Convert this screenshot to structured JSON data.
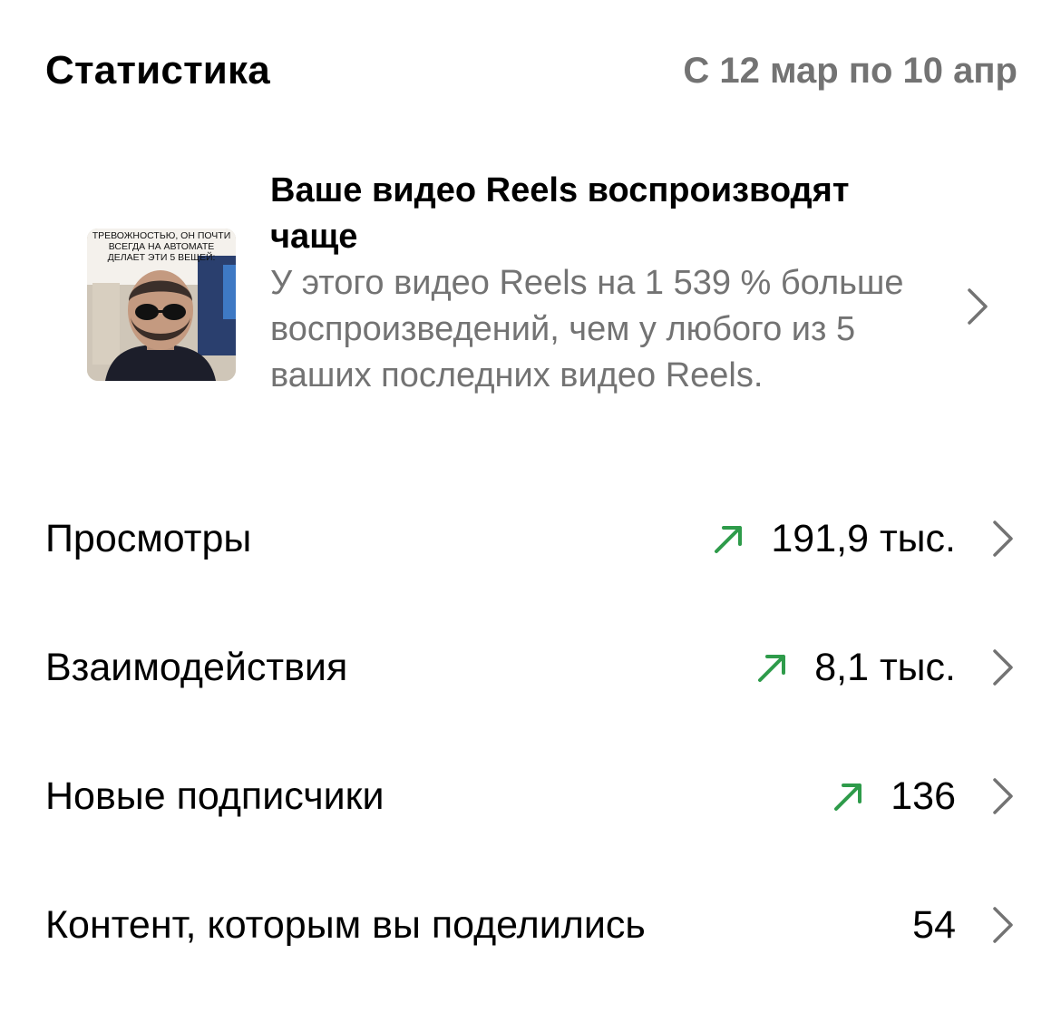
{
  "header": {
    "title": "Статистика",
    "date_range": "С 12 мар по 10 апр"
  },
  "insight": {
    "thumbnail_caption": "ТРЕВОЖНОСТЬЮ, ОН ПОЧТИ ВСЕГДА НА АВТОМАТЕ ДЕЛАЕТ ЭТИ 5 ВЕЩЕЙ:",
    "title": "Ваше видео Reels воспроизводят чаще",
    "body": "У этого видео Reels на 1 539 % больше воспроизведений, чем у любого из 5 ваших последних видео Reels."
  },
  "stats": [
    {
      "label": "Просмотры",
      "value": "191,9 тыс.",
      "trend": "up"
    },
    {
      "label": "Взаимодействия",
      "value": "8,1 тыс.",
      "trend": "up"
    },
    {
      "label": "Новые подписчики",
      "value": "136",
      "trend": "up"
    },
    {
      "label": "Контент, которым вы поделились",
      "value": "54",
      "trend": "none"
    }
  ],
  "colors": {
    "trend_up": "#2e9b4a",
    "secondary_text": "#737373",
    "chevron": "#737373"
  },
  "icons": {
    "trend": "trend-up-arrow-icon",
    "chevron": "chevron-right-icon"
  }
}
